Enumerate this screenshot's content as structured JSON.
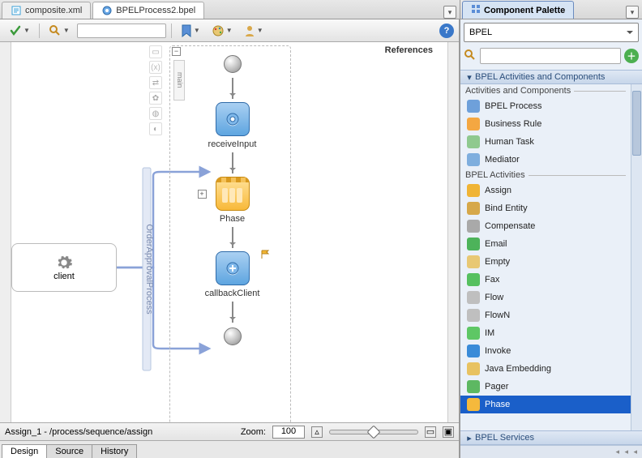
{
  "tabs": {
    "composite": "composite.xml",
    "bpel": "BPELProcess2.bpel"
  },
  "palette_title": "Component Palette",
  "palette_dropdown": "BPEL",
  "references_label": "References",
  "sections": {
    "top": "BPEL Activities and Components",
    "actcomp": "Activities and Components",
    "bpelact": "BPEL Activities",
    "bpelsvc": "BPEL Services"
  },
  "actcomp_items": [
    {
      "label": "BPEL Process",
      "color": "#6ea0da"
    },
    {
      "label": "Business Rule",
      "color": "#f4a742"
    },
    {
      "label": "Human Task",
      "color": "#8fc98f"
    },
    {
      "label": "Mediator",
      "color": "#7eaede"
    }
  ],
  "bpelact_items": [
    {
      "label": "Assign",
      "color": "#f0b435"
    },
    {
      "label": "Bind Entity",
      "color": "#d6a84a"
    },
    {
      "label": "Compensate",
      "color": "#a9a9a9"
    },
    {
      "label": "Email",
      "color": "#4db35a"
    },
    {
      "label": "Empty",
      "color": "#e8c874"
    },
    {
      "label": "Fax",
      "color": "#56c05f"
    },
    {
      "label": "Flow",
      "color": "#bfbfbf"
    },
    {
      "label": "FlowN",
      "color": "#bfbfbf"
    },
    {
      "label": "IM",
      "color": "#5ec765"
    },
    {
      "label": "Invoke",
      "color": "#3a8bd8"
    },
    {
      "label": "Java Embedding",
      "color": "#e8c261"
    },
    {
      "label": "Pager",
      "color": "#5db862"
    },
    {
      "label": "Phase",
      "color": "#f5b93c",
      "selected": true
    }
  ],
  "process": {
    "main_tab": "main",
    "receive": "receiveInput",
    "phase": "Phase",
    "callback": "callbackClient"
  },
  "swimlane_vert_label": "OrderApprovalProcess",
  "client": {
    "label": "client"
  },
  "status_path": "Assign_1 - /process/sequence/assign",
  "zoom": {
    "label": "Zoom:",
    "value": "100"
  },
  "src_tabs": {
    "design": "Design",
    "source": "Source",
    "history": "History"
  }
}
